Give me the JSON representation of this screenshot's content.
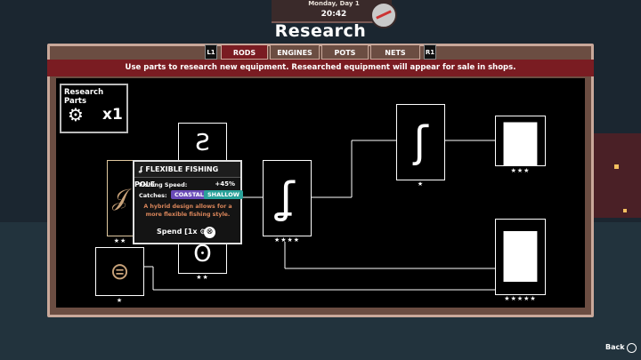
{
  "hud": {
    "day": "Monday, Day 1",
    "time": "20:42"
  },
  "screen": {
    "title": "Research",
    "banner": "Use parts to research new equipment. Researched equipment will appear for sale in shops."
  },
  "tabs": {
    "left_key": "L1",
    "right_key": "R1",
    "items": [
      {
        "label": "RODS",
        "active": true
      },
      {
        "label": "ENGINES",
        "active": false
      },
      {
        "label": "POTS",
        "active": false
      },
      {
        "label": "NETS",
        "active": false
      }
    ]
  },
  "research_parts": {
    "label": "Research Parts",
    "count": "x1",
    "icon": "gears-icon"
  },
  "tree": {
    "nodes": [
      {
        "name": "flexible-fishing-pole",
        "stars": "★★",
        "icon": "rod-icon"
      },
      {
        "name": "rod-2",
        "stars": "★★",
        "icon": "rod-icon"
      },
      {
        "name": "rod-3",
        "stars": "★★",
        "icon": "rod-icon"
      },
      {
        "name": "rod-4",
        "stars": "★★★★",
        "icon": "rod-icon"
      },
      {
        "name": "reel-1",
        "stars": "★",
        "icon": "reel-icon"
      },
      {
        "name": "rod-5",
        "stars": "★",
        "icon": "rod-icon"
      },
      {
        "name": "rod-6",
        "stars": "★★★",
        "icon": "rod-icon"
      },
      {
        "name": "rod-7",
        "stars": "★★★★★",
        "icon": "rod-icon"
      }
    ]
  },
  "tooltip": {
    "title": "FLEXIBLE FISHING POLE",
    "icon": "rod-icon",
    "speed_label": "Fishing Speed:",
    "speed_value": "+45%",
    "catches_label": "Catches:",
    "tags": [
      {
        "label": "COASTAL",
        "color": "#6a4bb8"
      },
      {
        "label": "SHALLOW",
        "color": "#2aa29a"
      }
    ],
    "description_line1": "A hybrid design allows for a",
    "description_line2": "more flexible fishing style.",
    "spend_label": "Spend [1x ⚙]"
  },
  "footer": {
    "back_label": "Back"
  },
  "colors": {
    "banner": "#7a1c22",
    "frame": "#6b4d42",
    "coastal": "#6a4bb8",
    "shallow": "#2aa29a",
    "description": "#d9855a"
  }
}
